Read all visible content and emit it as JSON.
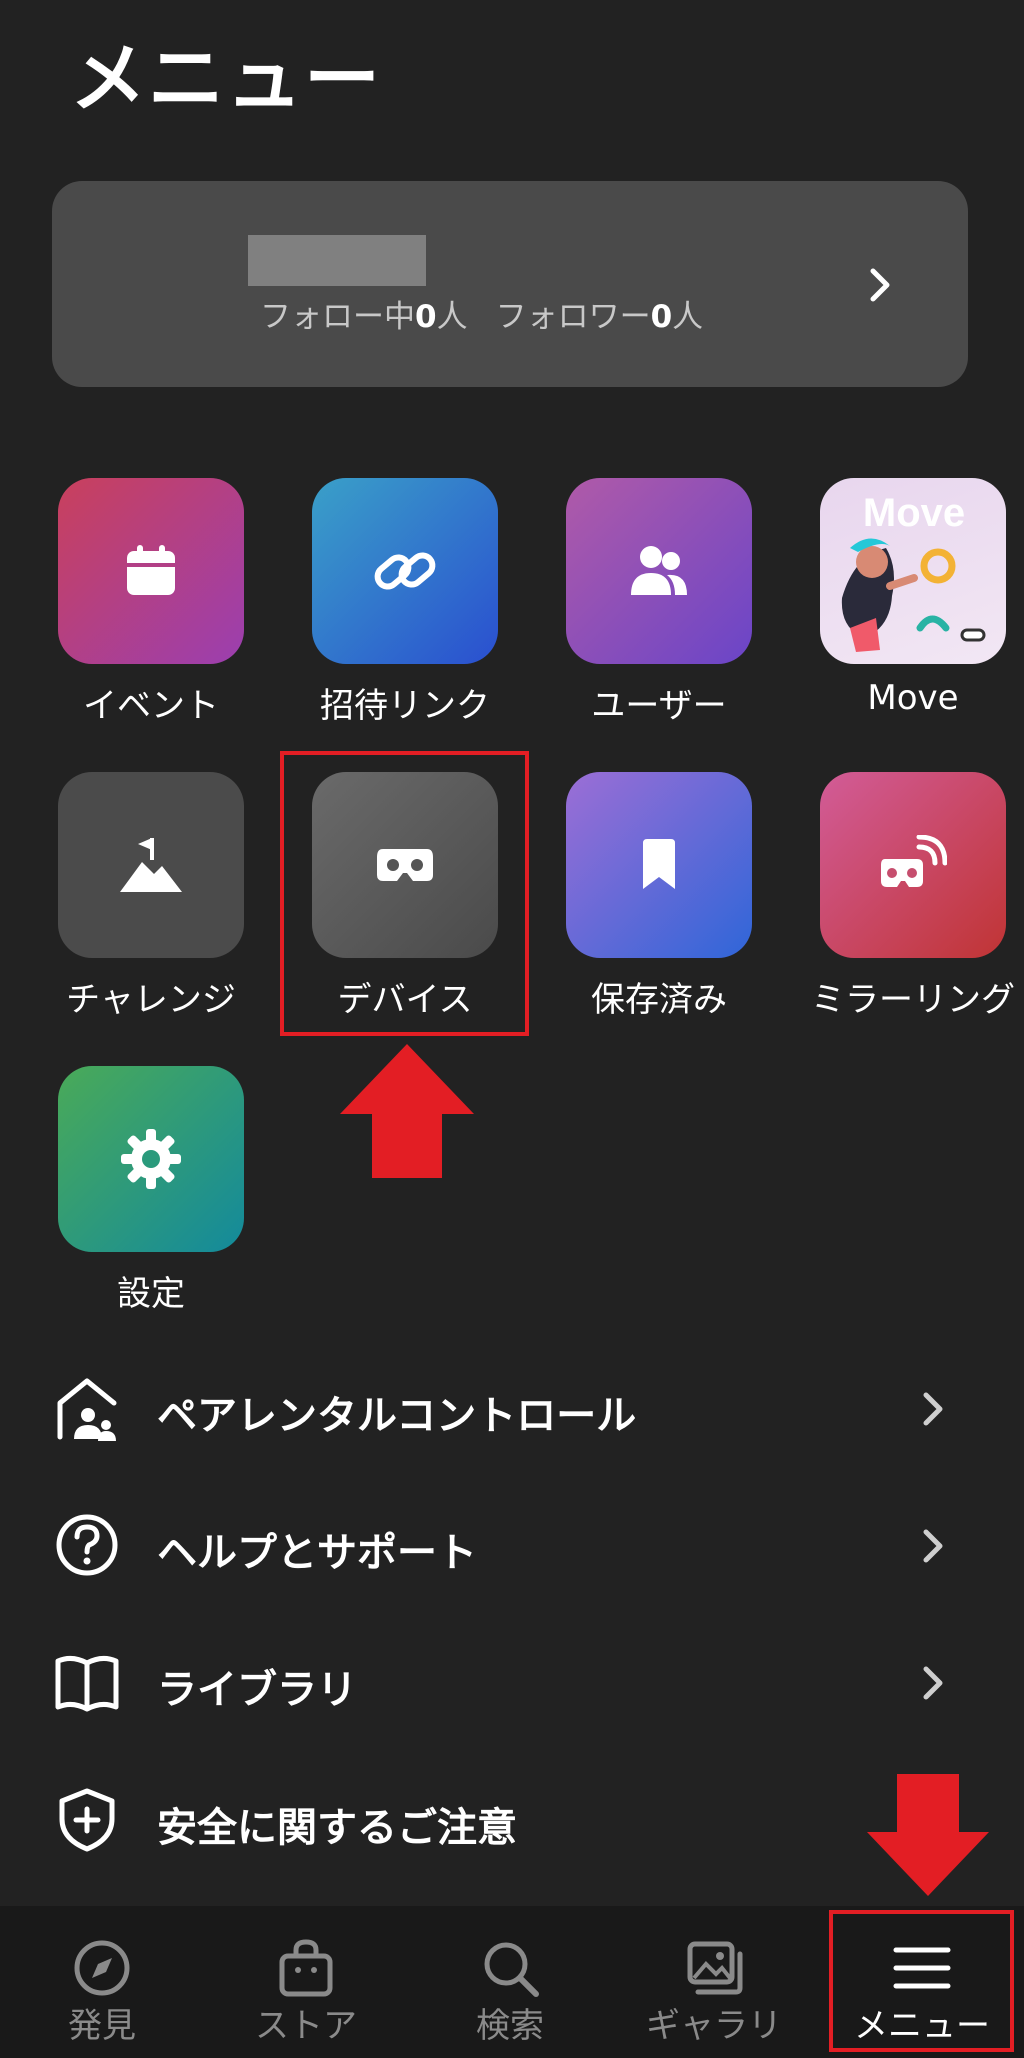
{
  "page_title": "メニュー",
  "profile": {
    "following_prefix": "フォロー中",
    "following_count": "0",
    "following_suffix": "人",
    "followers_prefix": "フォロワー",
    "followers_count": "0",
    "followers_suffix": "人"
  },
  "grid": [
    {
      "label": "イベント",
      "icon": "calendar-icon"
    },
    {
      "label": "招待リンク",
      "icon": "link-icon"
    },
    {
      "label": "ユーザー",
      "icon": "users-icon"
    },
    {
      "label": "Move",
      "icon": "move-app-thumbnail",
      "thumbnail_text": "Move"
    },
    {
      "label": "チャレンジ",
      "icon": "mountain-flag-icon"
    },
    {
      "label": "デバイス",
      "icon": "vr-headset-icon"
    },
    {
      "label": "保存済み",
      "icon": "bookmark-icon"
    },
    {
      "label": "ミラーリング",
      "icon": "cast-headset-icon"
    },
    {
      "label": "設定",
      "icon": "gear-icon"
    }
  ],
  "menu_list": [
    {
      "label": "ペアレンタルコントロール",
      "icon": "family-home-icon",
      "chevron": true
    },
    {
      "label": "ヘルプとサポート",
      "icon": "help-circle-icon",
      "chevron": true
    },
    {
      "label": "ライブラリ",
      "icon": "book-icon",
      "chevron": true
    },
    {
      "label": "安全に関するご注意",
      "icon": "shield-plus-icon",
      "chevron": false
    }
  ],
  "bottom_nav": [
    {
      "label": "発見",
      "icon": "compass-icon"
    },
    {
      "label": "ストア",
      "icon": "shopping-bag-icon"
    },
    {
      "label": "検索",
      "icon": "search-icon"
    },
    {
      "label": "ギャラリ",
      "icon": "gallery-icon"
    },
    {
      "label": "メニュー",
      "icon": "hamburger-menu-icon",
      "active": true
    }
  ],
  "colors": {
    "background": "#222222",
    "card": "#4a4a4a",
    "nav_background": "#191919",
    "annotation_red": "#e31e24"
  }
}
